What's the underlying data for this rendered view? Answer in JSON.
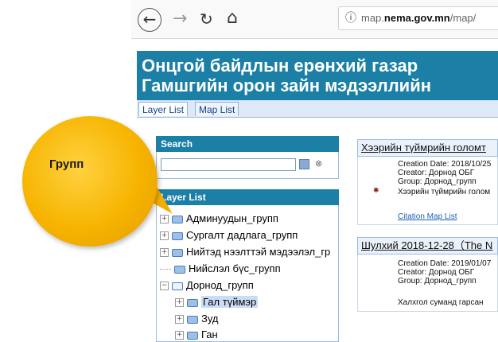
{
  "browser": {
    "back_icon": "back-arrow-icon",
    "forward_icon": "forward-arrow-icon",
    "reload_icon": "reload-icon",
    "home_icon": "home-icon",
    "url_prefix": "map.",
    "url_domain": "nema.gov.mn",
    "url_path": "/map/"
  },
  "header": {
    "line1": "Онцгой байдлын ерөнхий газар",
    "line2": "Гамшгийн орон зайн мэдээллийн"
  },
  "tabs": [
    {
      "label": "Layer List",
      "active": true
    },
    {
      "label": "Map List",
      "active": false
    }
  ],
  "search": {
    "title": "Search",
    "value": "",
    "clear_glyph": "⊗"
  },
  "layer_list": {
    "title": "Layer List",
    "items": [
      {
        "label": "Админуудын_групп",
        "level": 0,
        "expander": "+"
      },
      {
        "label": "Сургалт дадлага_групп",
        "level": 0,
        "expander": "+"
      },
      {
        "label": "Нийтэд нээлттэй мэдээлэл_гр",
        "level": 0,
        "expander": "+"
      },
      {
        "label": "Нийслэл бүс_групп",
        "level": 0,
        "expander": ""
      },
      {
        "label": "Дорнод_групп",
        "level": 0,
        "expander": "−"
      },
      {
        "label": "Гал түймэр",
        "level": 1,
        "expander": "+",
        "selected": true
      },
      {
        "label": "Зуд",
        "level": 1,
        "expander": "+"
      },
      {
        "label": "Ган",
        "level": 1,
        "expander": "+"
      }
    ]
  },
  "results": [
    {
      "title": "Хээрийн түймрийн голомт",
      "creation": "Creation Date: 2018/10/25",
      "creator": "Creator: Дорнод ОБГ",
      "group": "Group: Дорнод_групп",
      "desc": "Хээрийн түймрийн голом",
      "link": "Citation Map List"
    },
    {
      "title": "Шулхий 2018-12-28（The N",
      "creation": "Creation Date: 2019/01/07",
      "creator": "Creator: Дорнод ОБГ",
      "group": "Group: Дорнод_групп",
      "desc": "Халхгол суманд гарсан"
    }
  ],
  "callout": {
    "text": "Групп"
  }
}
